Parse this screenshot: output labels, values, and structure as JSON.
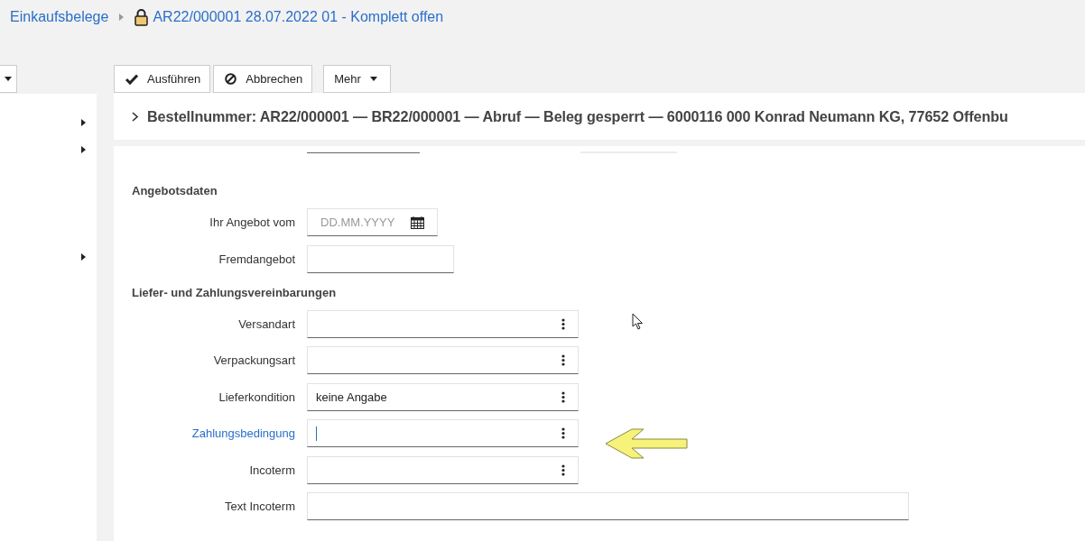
{
  "breadcrumb": {
    "parent": "Einkaufsbelege",
    "current": "AR22/000001 28.07.2022 01 - Komplett offen",
    "locked": true
  },
  "toolbar": {
    "buttons": [
      {
        "label": "Ausführen",
        "kind": "check"
      },
      {
        "label": "Abbrechen",
        "kind": "cancel"
      }
    ],
    "menu": {
      "label": "Mehr"
    }
  },
  "sidebar": {
    "items": [
      {
        "kind": "arrow"
      },
      {
        "kind": "arrow"
      },
      {
        "kind": "arrow"
      }
    ]
  },
  "header": {
    "expanded": false,
    "title": "Bestellnummer: AR22/000001 — BR22/000001 — Abruf — Beleg gesperrt — 6000116 000 Konrad Neumann KG, 77652 Offenbu"
  },
  "sections": [
    {
      "title": "Angebotsdaten",
      "fields": [
        {
          "label": "Ihr Angebot vom",
          "kind": "date",
          "placeholder": "DD.MM.YYYY",
          "focused": false
        },
        {
          "label": "Fremdangebot",
          "kind": "text",
          "focused": false
        }
      ]
    },
    {
      "title": "Liefer- und Zahlungsvereinbarungen",
      "fields": [
        {
          "label": "Versandart",
          "kind": "select",
          "focused": false
        },
        {
          "label": "Verpackungsart",
          "kind": "select",
          "focused": false
        },
        {
          "label": "Lieferkondition",
          "kind": "select",
          "value": "keine Angabe",
          "focused": false
        },
        {
          "label": "Zahlungsbedingung",
          "kind": "select",
          "focused": true
        },
        {
          "label": "Incoterm",
          "kind": "select",
          "focused": false
        },
        {
          "label": "Text Incoterm",
          "kind": "wide",
          "focused": false
        }
      ]
    }
  ]
}
